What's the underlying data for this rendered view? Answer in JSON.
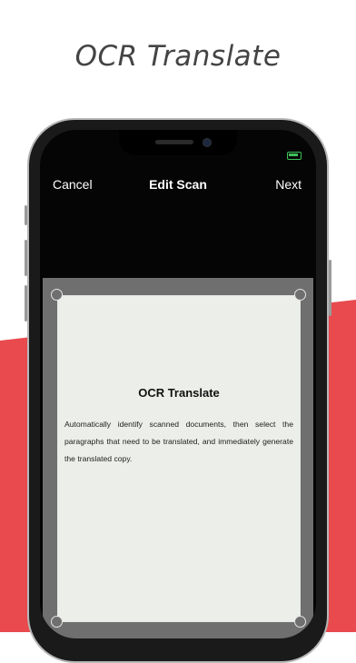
{
  "headline": "OCR Translate",
  "navbar": {
    "cancel_label": "Cancel",
    "title": "Edit Scan",
    "next_label": "Next"
  },
  "document": {
    "title": "OCR Translate",
    "body": "Automatically identify scanned documents, then select the paragraphs that need to be translated, and immediately generate the translated copy."
  },
  "colors": {
    "accent_red": "#e84a4e",
    "battery_green": "#3ec15a"
  }
}
